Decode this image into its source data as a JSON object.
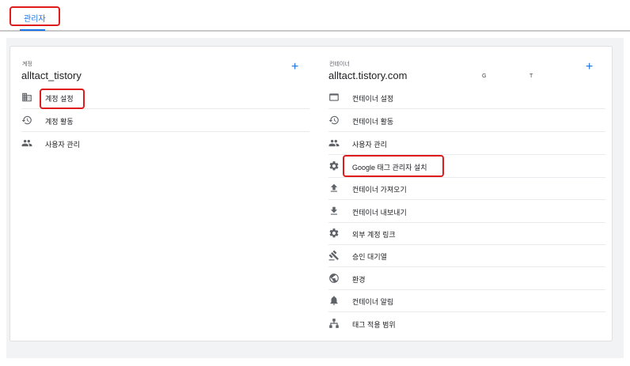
{
  "tabs": [
    {
      "label": "관리자"
    }
  ],
  "account": {
    "section_label": "계정",
    "name": "alltact_tistory",
    "items": [
      {
        "label": "계정 설정",
        "icon": "building-icon"
      },
      {
        "label": "계정 활동",
        "icon": "history-icon"
      },
      {
        "label": "사용자 관리",
        "icon": "people-icon"
      }
    ]
  },
  "container": {
    "section_label": "컨테이너",
    "name": "alltact.tistory.com",
    "meta_a": "G",
    "meta_b": "T",
    "items": [
      {
        "label": "컨테이너 설정",
        "icon": "browser-icon"
      },
      {
        "label": "컨테이너 활동",
        "icon": "history-icon"
      },
      {
        "label": "사용자 관리",
        "icon": "people-icon"
      },
      {
        "label": "Google 태그 관리자 설치",
        "icon": "gear-icon"
      },
      {
        "label": "컨테이너 가져오기",
        "icon": "upload-icon"
      },
      {
        "label": "컨테이너 내보내기",
        "icon": "download-icon"
      },
      {
        "label": "외부 계정 링크",
        "icon": "gear-icon"
      },
      {
        "label": "승인 대기열",
        "icon": "gavel-icon"
      },
      {
        "label": "환경",
        "icon": "globe-icon"
      },
      {
        "label": "컨테이너 알림",
        "icon": "bell-icon"
      },
      {
        "label": "태그 적용 범위",
        "icon": "sitemap-icon"
      }
    ]
  },
  "colors": {
    "accent": "#1a73e8",
    "highlight": "#e01b1b",
    "icon": "#5f6368"
  }
}
